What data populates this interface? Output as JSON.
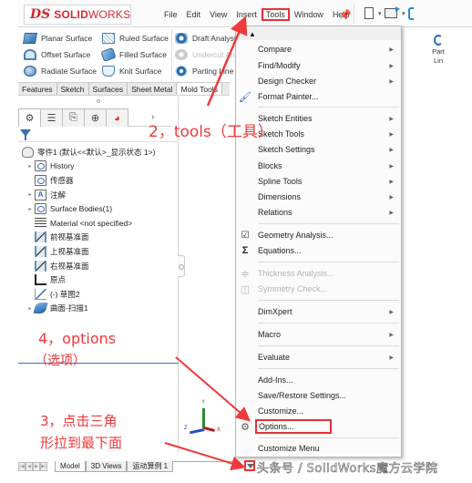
{
  "app": {
    "logo_ds": "DS",
    "logo_bold": "SOLID",
    "logo_light": "WORKS"
  },
  "menubar": {
    "items": [
      {
        "label": "File"
      },
      {
        "label": "Edit"
      },
      {
        "label": "View"
      },
      {
        "label": "Insert"
      },
      {
        "label": "Tools",
        "active": true
      },
      {
        "label": "Window"
      },
      {
        "label": "Help"
      }
    ]
  },
  "command_manager": {
    "items": [
      {
        "label": "Planar Surface",
        "icon": "planar-surface-icon"
      },
      {
        "label": "Offset Surface",
        "icon": "offset-surface-icon"
      },
      {
        "label": "Radiate Surface",
        "icon": "radiate-surface-icon"
      },
      {
        "label": "Ruled Surface",
        "icon": "ruled-surface-icon"
      },
      {
        "label": "Filled Surface",
        "icon": "filled-surface-icon"
      },
      {
        "label": "Knit Surface",
        "icon": "knit-surface-icon"
      },
      {
        "label": "Draft Analysis",
        "icon": "draft-analysis-icon"
      },
      {
        "label": "Undercut Analysis",
        "icon": "undercut-analysis-icon",
        "disabled": true
      },
      {
        "label": "Parting Line Analysis",
        "icon": "parting-line-analysis-icon"
      }
    ],
    "right_item": {
      "line1": "Part",
      "line2": "Lin"
    }
  },
  "tabs": [
    {
      "label": "Features"
    },
    {
      "label": "Sketch"
    },
    {
      "label": "Surfaces"
    },
    {
      "label": "Sheet Metal"
    },
    {
      "label": "Mold Tools",
      "active": true
    }
  ],
  "feature_tree": {
    "panel_tabs": [
      "feature-manager-icon",
      "property-manager-icon",
      "configuration-manager-icon",
      "dimxpert-icon",
      "display-manager-icon"
    ],
    "root": "零件1  (默认<<默认>_显示状态 1>)",
    "items": [
      {
        "label": "History",
        "icon": "history-folder-icon",
        "expandable": true
      },
      {
        "label": "传感器",
        "icon": "sensors-folder-icon",
        "expandable": false
      },
      {
        "label": "注解",
        "icon": "annotations-icon",
        "expandable": true
      },
      {
        "label": "Surface Bodies(1)",
        "icon": "surface-bodies-icon",
        "expandable": true
      },
      {
        "label": "Material <not specified>",
        "icon": "material-icon",
        "expandable": false
      },
      {
        "label": "前视基准面",
        "icon": "plane-icon",
        "expandable": false
      },
      {
        "label": "上视基准面",
        "icon": "plane-icon",
        "expandable": false
      },
      {
        "label": "右视基准面",
        "icon": "plane-icon",
        "expandable": false
      },
      {
        "label": "原点",
        "icon": "origin-icon",
        "expandable": false
      },
      {
        "label": "(-) 草图2",
        "icon": "sketch-icon",
        "expandable": false
      },
      {
        "label": "曲面-扫描1",
        "icon": "sweep-surface-icon",
        "expandable": true
      }
    ]
  },
  "triad": {
    "x": "X",
    "y": "Y",
    "z": "Z"
  },
  "bottom_tabs": [
    {
      "label": "Model",
      "active": true
    },
    {
      "label": "3D Views"
    },
    {
      "label": "运动算例 1"
    }
  ],
  "tools_menu": {
    "collapse_glyph": "▲",
    "items": [
      {
        "label": "Compare",
        "submenu": true
      },
      {
        "label": "Find/Modify",
        "submenu": true
      },
      {
        "label": "Design Checker",
        "submenu": true
      },
      {
        "label": "Format Painter...",
        "icon": "format-painter-icon"
      },
      {
        "label": "Sketch Entities",
        "submenu": true
      },
      {
        "label": "Sketch Tools",
        "submenu": true
      },
      {
        "label": "Sketch Settings",
        "submenu": true
      },
      {
        "label": "Blocks",
        "submenu": true
      },
      {
        "label": "Spline Tools",
        "submenu": true
      },
      {
        "label": "Dimensions",
        "submenu": true
      },
      {
        "label": "Relations",
        "submenu": true
      },
      {
        "label": "Geometry Analysis...",
        "icon": "geometry-analysis-icon"
      },
      {
        "label": "Equations...",
        "icon": "sigma-icon"
      },
      {
        "label": "Thickness Analysis...",
        "icon": "thickness-analysis-icon",
        "disabled": true
      },
      {
        "label": "Symmetry Check...",
        "icon": "symmetry-check-icon",
        "disabled": true
      },
      {
        "label": "DimXpert",
        "submenu": true
      },
      {
        "label": "Macro",
        "submenu": true
      },
      {
        "label": "Evaluate",
        "submenu": true
      },
      {
        "label": "Add-Ins..."
      },
      {
        "label": "Save/Restore Settings..."
      },
      {
        "label": "Customize..."
      },
      {
        "label": "Options...",
        "icon": "gear-icon",
        "highlighted": true
      },
      {
        "label": "Customize Menu"
      }
    ]
  },
  "annotations": {
    "step2": "2，tools（工具）",
    "step4_line1": "4，options",
    "step4_line2": "（选项）",
    "step3_line1": "3，点击三角",
    "step3_line2": "形拉到最下面"
  },
  "watermark": "头条号 / SolidWorks魔方云学院",
  "colors": {
    "annotation_red": "#f0393a",
    "brand_red": "#d6282d",
    "accent_blue": "#3a70b8"
  }
}
